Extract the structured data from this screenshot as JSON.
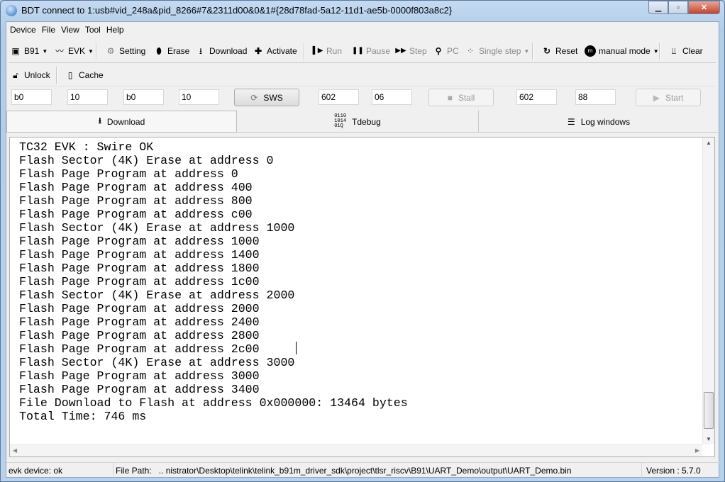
{
  "window": {
    "title": "BDT connect to 1:usb#vid_248a&pid_8266#7&2311d00&0&1#{28d78fad-5a12-11d1-ae5b-0000f803a8c2}"
  },
  "menu": [
    "Device",
    "File",
    "View",
    "Tool",
    "Help"
  ],
  "toolbar1": {
    "chip": "B91",
    "board": "EVK",
    "setting": "Setting",
    "erase": "Erase",
    "download": "Download",
    "activate": "Activate",
    "run": "Run",
    "pause": "Pause",
    "step": "Step",
    "pc": "PC",
    "single_step": "Single step",
    "reset": "Reset",
    "mode": "manual mode",
    "clear": "Clear"
  },
  "toolbar2": {
    "unlock": "Unlock",
    "cache": "Cache"
  },
  "swire": {
    "inputs": [
      "b0",
      "10",
      "b0",
      "10"
    ],
    "sws_label": "SWS",
    "stall_inputs": [
      "602",
      "06"
    ],
    "stall_label": "Stall",
    "start_inputs": [
      "602",
      "88"
    ],
    "start_label": "Start"
  },
  "tabs": [
    {
      "label": "Download"
    },
    {
      "label": "Tdebug"
    },
    {
      "label": "Log windows"
    }
  ],
  "log": {
    "lines": [
      "TC32 EVK : Swire OK",
      "Flash Sector (4K) Erase at address 0",
      "Flash Page Program at address 0",
      "Flash Page Program at address 400",
      "Flash Page Program at address 800",
      "Flash Page Program at address c00",
      "Flash Sector (4K) Erase at address 1000",
      "Flash Page Program at address 1000",
      "Flash Page Program at address 1400",
      "Flash Page Program at address 1800",
      "Flash Page Program at address 1c00",
      "Flash Sector (4K) Erase at address 2000",
      "Flash Page Program at address 2000",
      "Flash Page Program at address 2400",
      "Flash Page Program at address 2800",
      "Flash Page Program at address 2c00",
      "Flash Sector (4K) Erase at address 3000",
      "Flash Page Program at address 3000",
      "Flash Page Program at address 3400",
      "File Download to Flash at address 0x000000: 13464 bytes",
      "Total Time: 746 ms"
    ]
  },
  "status": {
    "device": "evk device: ok",
    "file_label": "File Path:",
    "file_path": "..  nistrator\\Desktop\\telink\\telink_b91m_driver_sdk\\project\\tlsr_riscv\\B91\\UART_Demo\\output\\UART_Demo.bin",
    "version": "Version : 5.7.0"
  }
}
